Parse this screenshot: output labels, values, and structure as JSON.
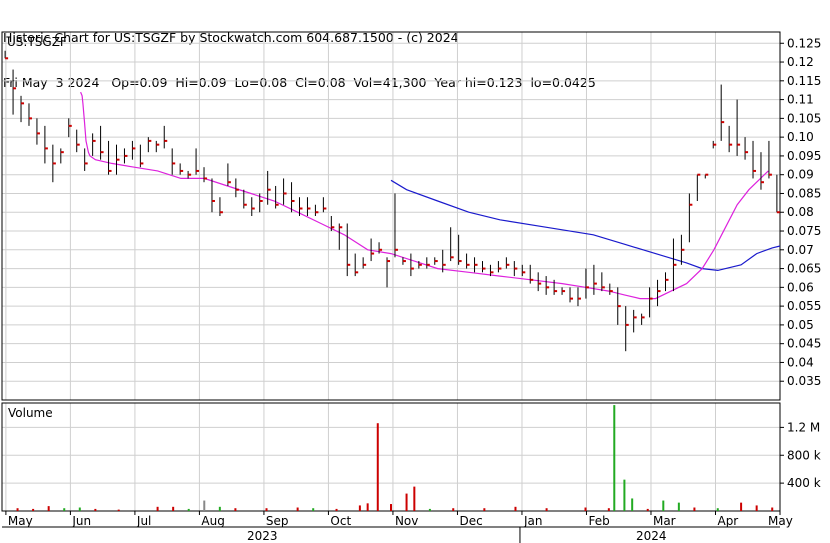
{
  "header": {
    "line1": "Historic Chart for US:TSGZF by Stockwatch.com 604.687.1500 - (c) 2024",
    "line2": "Fri May  3 2024   Op=0.09  Hi=0.09  Lo=0.08  Cl=0.08  Vol=41,300  Year hi=0.123  lo=0.0425"
  },
  "chart_data": [
    {
      "type": "ohlc",
      "symbol_label": "US:TSGZF",
      "price_ticks": [
        0.125,
        0.12,
        0.115,
        0.11,
        0.105,
        0.1,
        0.095,
        0.09,
        0.085,
        0.08,
        0.075,
        0.07,
        0.065,
        0.06,
        0.055,
        0.05,
        0.045,
        0.04,
        0.035
      ],
      "tick_labels": [
        "0.125",
        "0.12",
        "0.115",
        "0.11",
        "0.105",
        "0.10",
        "0.095",
        "0.09",
        "0.085",
        "0.08",
        "0.075",
        "0.07",
        "0.065",
        "0.06",
        "0.055",
        "0.05",
        "0.045",
        "0.04",
        "0.035"
      ],
      "ylim": [
        0.03,
        0.128
      ],
      "months": [
        "May",
        "Jun",
        "Jul",
        "Aug",
        "Sep",
        "Oct",
        "Nov",
        "Dec",
        "Jan",
        "Feb",
        "Mar",
        "Apr",
        "May"
      ],
      "years": [
        "2023",
        "2024"
      ],
      "colors": {
        "bar": "#000000",
        "close_tick": "#cc0000",
        "ma_short": "#dd22dd",
        "ma_long": "#1a1acc",
        "grid": "#cfcfcf"
      },
      "bars": [
        [
          0.123,
          0.121,
          0.121
        ],
        [
          0.118,
          0.106,
          0.113
        ],
        [
          0.111,
          0.104,
          0.109
        ],
        [
          0.109,
          0.103,
          0.105
        ],
        [
          0.105,
          0.098,
          0.101
        ],
        [
          0.103,
          0.093,
          0.097
        ],
        [
          0.098,
          0.088,
          0.093
        ],
        [
          0.097,
          0.093,
          0.096
        ],
        [
          0.105,
          0.1,
          0.103
        ],
        [
          0.102,
          0.096,
          0.098
        ],
        [
          0.097,
          0.091,
          0.093
        ],
        [
          0.101,
          0.095,
          0.099
        ],
        [
          0.103,
          0.094,
          0.096
        ],
        [
          0.099,
          0.09,
          0.091
        ],
        [
          0.098,
          0.09,
          0.094
        ],
        [
          0.097,
          0.093,
          0.095
        ],
        [
          0.099,
          0.094,
          0.097
        ],
        [
          0.098,
          0.092,
          0.093
        ],
        [
          0.1,
          0.096,
          0.099
        ],
        [
          0.099,
          0.096,
          0.098
        ],
        [
          0.103,
          0.097,
          0.099
        ],
        [
          0.097,
          0.09,
          0.093
        ],
        [
          0.093,
          0.09,
          0.091
        ],
        [
          0.091,
          0.089,
          0.09
        ],
        [
          0.097,
          0.09,
          0.091
        ],
        [
          0.092,
          0.088,
          0.089
        ],
        [
          0.089,
          0.08,
          0.083
        ],
        [
          0.084,
          0.079,
          0.08
        ],
        [
          0.093,
          0.087,
          0.088
        ],
        [
          0.089,
          0.084,
          0.086
        ],
        [
          0.086,
          0.081,
          0.082
        ],
        [
          0.084,
          0.079,
          0.081
        ],
        [
          0.085,
          0.08,
          0.083
        ],
        [
          0.091,
          0.082,
          0.086
        ],
        [
          0.087,
          0.081,
          0.082
        ],
        [
          0.089,
          0.082,
          0.085
        ],
        [
          0.088,
          0.08,
          0.083
        ],
        [
          0.084,
          0.079,
          0.081
        ],
        [
          0.084,
          0.079,
          0.081
        ],
        [
          0.082,
          0.079,
          0.08
        ],
        [
          0.084,
          0.08,
          0.081
        ],
        [
          0.079,
          0.075,
          0.076
        ],
        [
          0.077,
          0.07,
          0.076
        ],
        [
          0.077,
          0.063,
          0.066
        ],
        [
          0.069,
          0.063,
          0.064
        ],
        [
          0.068,
          0.065,
          0.066
        ],
        [
          0.073,
          0.067,
          0.069
        ],
        [
          0.072,
          0.069,
          0.07
        ],
        [
          0.068,
          0.06,
          0.067
        ],
        [
          0.085,
          0.068,
          0.07
        ],
        [
          0.068,
          0.066,
          0.067
        ],
        [
          0.069,
          0.063,
          0.065
        ],
        [
          0.067,
          0.065,
          0.066
        ],
        [
          0.068,
          0.065,
          0.066
        ],
        [
          0.068,
          0.066,
          0.067
        ],
        [
          0.07,
          0.064,
          0.066
        ],
        [
          0.076,
          0.067,
          0.068
        ],
        [
          0.074,
          0.066,
          0.067
        ],
        [
          0.069,
          0.065,
          0.066
        ],
        [
          0.068,
          0.064,
          0.066
        ],
        [
          0.067,
          0.064,
          0.065
        ],
        [
          0.066,
          0.063,
          0.064
        ],
        [
          0.067,
          0.064,
          0.065
        ],
        [
          0.068,
          0.065,
          0.066
        ],
        [
          0.067,
          0.063,
          0.065
        ],
        [
          0.066,
          0.063,
          0.064
        ],
        [
          0.066,
          0.061,
          0.062
        ],
        [
          0.064,
          0.059,
          0.061
        ],
        [
          0.063,
          0.058,
          0.06
        ],
        [
          0.062,
          0.058,
          0.059
        ],
        [
          0.06,
          0.058,
          0.059
        ],
        [
          0.06,
          0.056,
          0.057
        ],
        [
          0.06,
          0.055,
          0.057
        ],
        [
          0.065,
          0.057,
          0.06
        ],
        [
          0.066,
          0.058,
          0.061
        ],
        [
          0.064,
          0.059,
          0.06
        ],
        [
          0.061,
          0.058,
          0.059
        ],
        [
          0.06,
          0.05,
          0.055
        ],
        [
          0.055,
          0.043,
          0.05
        ],
        [
          0.054,
          0.048,
          0.052
        ],
        [
          0.053,
          0.05,
          0.052
        ],
        [
          0.06,
          0.052,
          0.057
        ],
        [
          0.062,
          0.055,
          0.059
        ],
        [
          0.064,
          0.059,
          0.062
        ],
        [
          0.073,
          0.059,
          0.066
        ],
        [
          0.074,
          0.066,
          0.07
        ],
        [
          0.085,
          0.072,
          0.082
        ],
        [
          0.09,
          0.083,
          0.09
        ],
        [
          0.09,
          0.089,
          0.09
        ],
        [
          0.099,
          0.097,
          0.098
        ],
        [
          0.114,
          0.099,
          0.104
        ],
        [
          0.103,
          0.096,
          0.098
        ],
        [
          0.11,
          0.095,
          0.098
        ],
        [
          0.1,
          0.094,
          0.096
        ],
        [
          0.099,
          0.089,
          0.091
        ],
        [
          0.096,
          0.086,
          0.088
        ],
        [
          0.099,
          0.089,
          0.09
        ],
        [
          0.09,
          0.08,
          0.08
        ]
      ],
      "ma_short": [
        [
          0.101,
          0.112
        ],
        [
          0.103,
          0.111
        ],
        [
          0.104,
          0.109
        ],
        [
          0.106,
          0.104
        ],
        [
          0.108,
          0.099
        ],
        [
          0.111,
          0.096
        ],
        [
          0.113,
          0.095
        ],
        [
          0.12,
          0.094
        ],
        [
          0.141,
          0.093
        ],
        [
          0.17,
          0.092
        ],
        [
          0.2,
          0.091
        ],
        [
          0.23,
          0.089
        ],
        [
          0.26,
          0.089
        ],
        [
          0.29,
          0.087
        ],
        [
          0.32,
          0.085
        ],
        [
          0.35,
          0.083
        ],
        [
          0.38,
          0.08
        ],
        [
          0.41,
          0.077
        ],
        [
          0.44,
          0.074
        ],
        [
          0.47,
          0.07
        ],
        [
          0.5,
          0.069
        ],
        [
          0.53,
          0.067
        ],
        [
          0.56,
          0.065
        ],
        [
          0.6,
          0.064
        ],
        [
          0.64,
          0.063
        ],
        [
          0.68,
          0.062
        ],
        [
          0.72,
          0.061
        ],
        [
          0.75,
          0.06
        ],
        [
          0.78,
          0.059
        ],
        [
          0.8,
          0.058
        ],
        [
          0.82,
          0.057
        ],
        [
          0.84,
          0.057
        ],
        [
          0.86,
          0.059
        ],
        [
          0.88,
          0.061
        ],
        [
          0.9,
          0.065
        ],
        [
          0.915,
          0.07
        ],
        [
          0.93,
          0.076
        ],
        [
          0.945,
          0.082
        ],
        [
          0.96,
          0.086
        ],
        [
          0.975,
          0.089
        ],
        [
          0.985,
          0.091
        ]
      ],
      "ma_long": [
        [
          0.5,
          0.0885
        ],
        [
          0.52,
          0.086
        ],
        [
          0.56,
          0.083
        ],
        [
          0.6,
          0.08
        ],
        [
          0.64,
          0.078
        ],
        [
          0.7,
          0.076
        ],
        [
          0.76,
          0.074
        ],
        [
          0.8,
          0.0715
        ],
        [
          0.84,
          0.069
        ],
        [
          0.88,
          0.0665
        ],
        [
          0.9,
          0.065
        ],
        [
          0.92,
          0.0645
        ],
        [
          0.95,
          0.066
        ],
        [
          0.97,
          0.069
        ],
        [
          0.99,
          0.0705
        ],
        [
          1.0,
          0.071
        ]
      ],
      "volume": {
        "label": "Volume",
        "tick_labels": [
          "1.2 M",
          "800 k",
          "400 k"
        ],
        "tick_values": [
          1200000,
          800000,
          400000
        ],
        "ymax": 1550000,
        "colors": {
          "up": "#22aa22",
          "down": "#cc0000",
          "flat": "#888888"
        },
        "bars": [
          [
            0.02,
            40000,
            "down"
          ],
          [
            0.04,
            30000,
            "down"
          ],
          [
            0.06,
            70000,
            "down"
          ],
          [
            0.08,
            40000,
            "up"
          ],
          [
            0.1,
            50000,
            "up"
          ],
          [
            0.12,
            30000,
            "down"
          ],
          [
            0.15,
            20000,
            "down"
          ],
          [
            0.2,
            60000,
            "down"
          ],
          [
            0.22,
            60000,
            "down"
          ],
          [
            0.24,
            30000,
            "up"
          ],
          [
            0.26,
            150000,
            "flat"
          ],
          [
            0.28,
            60000,
            "up"
          ],
          [
            0.3,
            40000,
            "down"
          ],
          [
            0.34,
            40000,
            "down"
          ],
          [
            0.38,
            50000,
            "down"
          ],
          [
            0.4,
            40000,
            "up"
          ],
          [
            0.43,
            30000,
            "down"
          ],
          [
            0.46,
            80000,
            "down"
          ],
          [
            0.47,
            110000,
            "down"
          ],
          [
            0.483,
            1260000,
            "down"
          ],
          [
            0.5,
            100000,
            "down"
          ],
          [
            0.52,
            250000,
            "down"
          ],
          [
            0.53,
            350000,
            "down"
          ],
          [
            0.55,
            30000,
            "up"
          ],
          [
            0.58,
            40000,
            "down"
          ],
          [
            0.62,
            40000,
            "down"
          ],
          [
            0.66,
            60000,
            "down"
          ],
          [
            0.7,
            40000,
            "down"
          ],
          [
            0.75,
            50000,
            "down"
          ],
          [
            0.78,
            40000,
            "down"
          ],
          [
            0.787,
            1520000,
            "up"
          ],
          [
            0.8,
            450000,
            "up"
          ],
          [
            0.81,
            180000,
            "up"
          ],
          [
            0.83,
            30000,
            "down"
          ],
          [
            0.85,
            150000,
            "up"
          ],
          [
            0.87,
            120000,
            "up"
          ],
          [
            0.89,
            50000,
            "down"
          ],
          [
            0.92,
            40000,
            "up"
          ],
          [
            0.95,
            120000,
            "down"
          ],
          [
            0.97,
            80000,
            "down"
          ],
          [
            0.99,
            50000,
            "down"
          ]
        ]
      }
    }
  ]
}
